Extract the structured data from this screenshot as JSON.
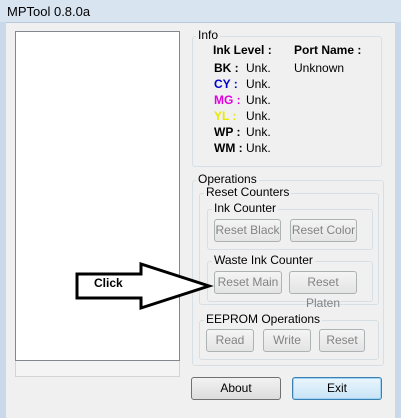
{
  "window": {
    "title": "MPTool 0.8.0a"
  },
  "info": {
    "group_label": "Info",
    "ink_level_header": "Ink Level :",
    "port_name_header": "Port Name :",
    "port_name_value": "Unknown",
    "inks": [
      {
        "code": "BK :",
        "value": "Unk.",
        "color": "#000000"
      },
      {
        "code": "CY :",
        "value": "Unk.",
        "color": "#0000cc"
      },
      {
        "code": "MG :",
        "value": "Unk.",
        "color": "#e000e0"
      },
      {
        "code": "YL :",
        "value": "Unk.",
        "color": "#e8e800"
      },
      {
        "code": "WP :",
        "value": "Unk.",
        "color": "#000000"
      },
      {
        "code": "WM :",
        "value": "Unk.",
        "color": "#000000"
      }
    ]
  },
  "operations": {
    "group_label": "Operations",
    "reset_counters": {
      "label": "Reset Counters",
      "ink_counter": {
        "label": "Ink Counter",
        "reset_black": "Reset Black",
        "reset_color": "Reset Color"
      },
      "waste_ink_counter": {
        "label": "Waste Ink Counter",
        "reset_main": "Reset Main",
        "reset_platen": "Reset Platen"
      }
    },
    "eeprom": {
      "label": "EEPROM Operations",
      "read": "Read",
      "write": "Write",
      "reset": "Reset"
    }
  },
  "footer": {
    "about": "About",
    "exit": "Exit"
  },
  "annotation": {
    "click_label": "Click"
  }
}
